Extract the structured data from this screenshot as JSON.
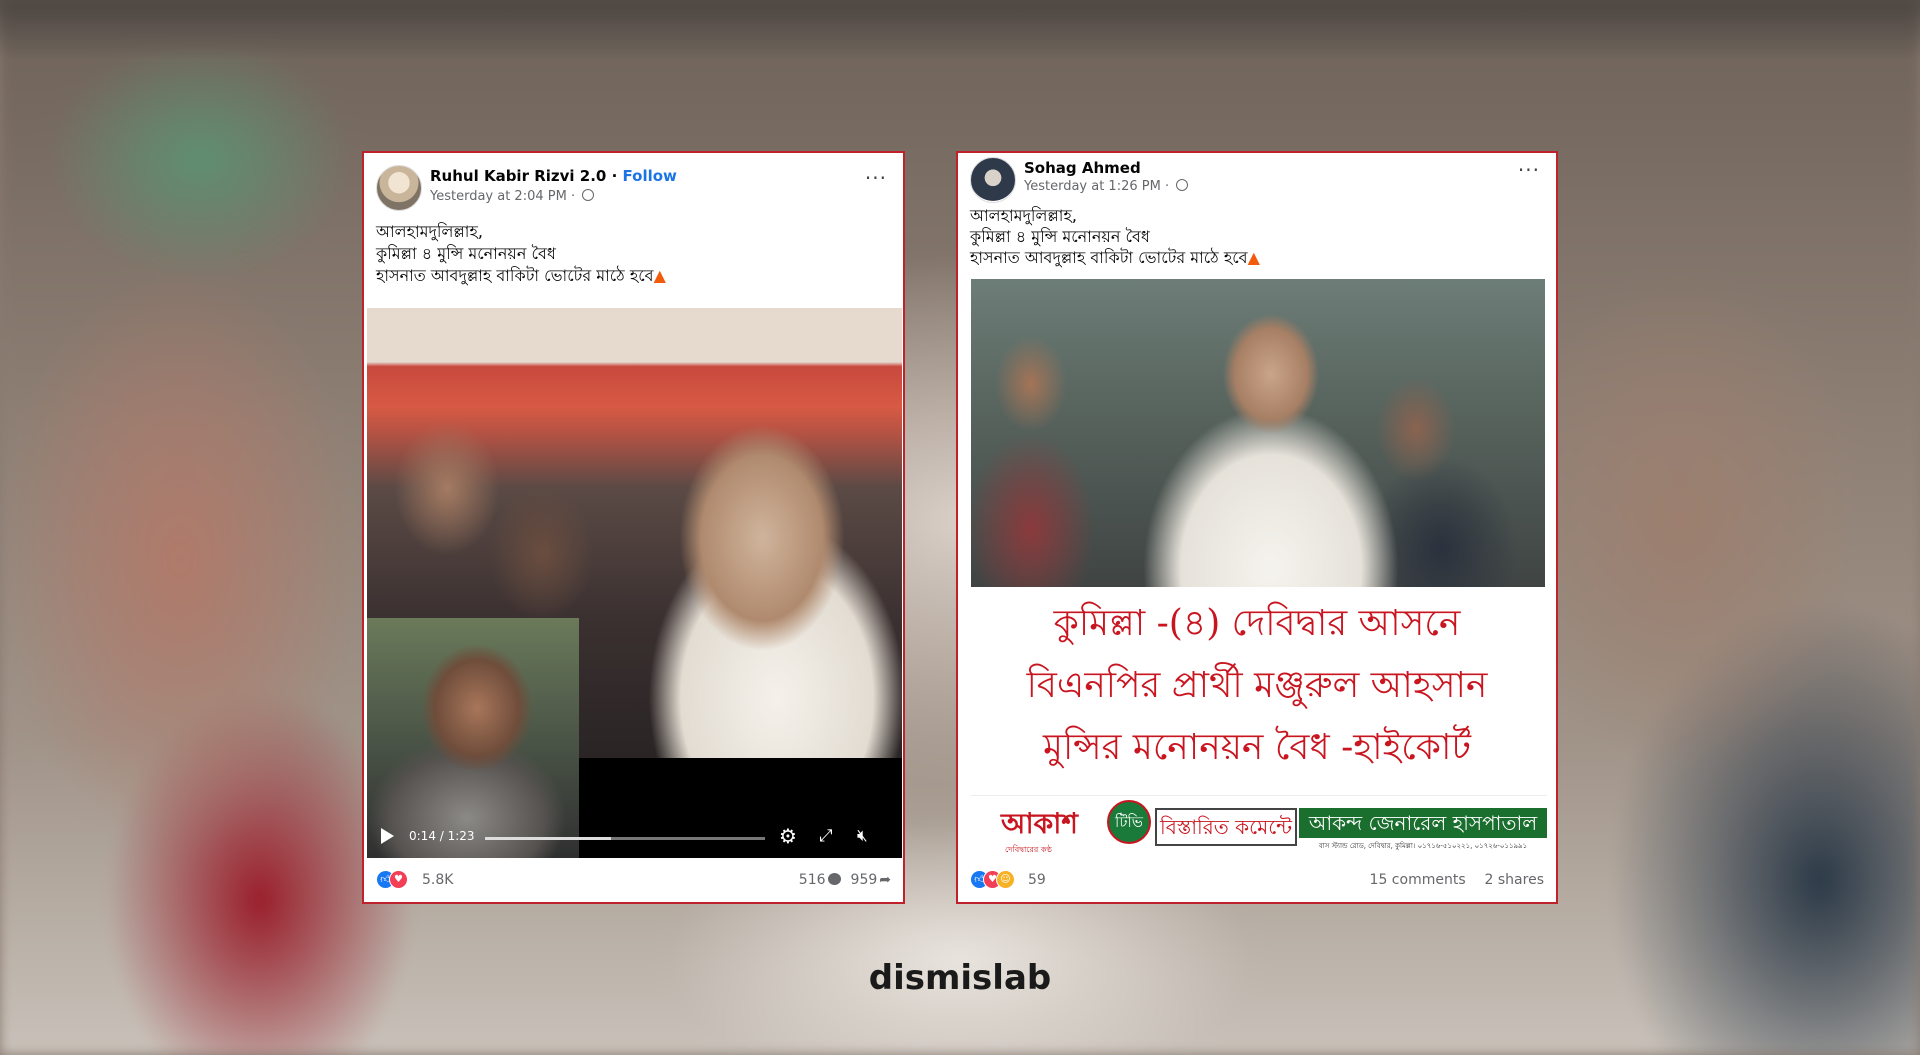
{
  "left_post": {
    "author": "Ruhul Kabir Rizvi 2.0",
    "follow_label": "Follow",
    "timestamp": "Yesterday at 2:04 PM",
    "caption": "আলহামদুলিল্লাহ,\nকুমিল্লা ৪ মুন্সি মনোনয়ন বৈধ\nহাসনাত আবদুল্লাহ বাকিটা ভোটের মাঠে হবে",
    "video_time": "0:14 / 1:23",
    "video_progress": 0.45,
    "reaction_count": "5.8K",
    "comments": "516",
    "shares": "959"
  },
  "right_post": {
    "author": "Sohag Ahmed",
    "timestamp": "Yesterday at 1:26 PM",
    "caption": "আলহামদুলিল্লাহ,\nকুমিল্লা ৪ মুন্সি মনোনয়ন বৈধ\nহাসনাত আবদুল্লাহ বাকিটা ভোটের মাঠে হবে",
    "headline_lines": [
      "কুমিল্লা -(৪) দেবিদ্বার আসনে",
      "বিএনপির প্রার্থী মঞ্জুরুল আহসান",
      "মুন্সির মনোনয়ন বৈধ -হাইকোর্ট"
    ],
    "banner": {
      "logo": "আকাশ",
      "tv_badge": "টিভি",
      "logo_sub": "দেবিদ্বারের কণ্ঠ",
      "comment_box": "বিস্তারিত কমেন্টে",
      "hospital": "আকন্দ জেনারেল হাসপাতাল",
      "address": "বাস স্ট্যান্ড রোড, দেবিদ্বার, কুমিল্লা। ০১৭১৬-৫১০২২১, ০১৭২৬-০১১৯৯১"
    },
    "reaction_count": "59",
    "comments": "15 comments",
    "shares": "2 shares"
  },
  "brand": "dismislab",
  "colors": {
    "frame": "#c0222c",
    "link": "#1b74e4",
    "headline": "#c8151f"
  }
}
